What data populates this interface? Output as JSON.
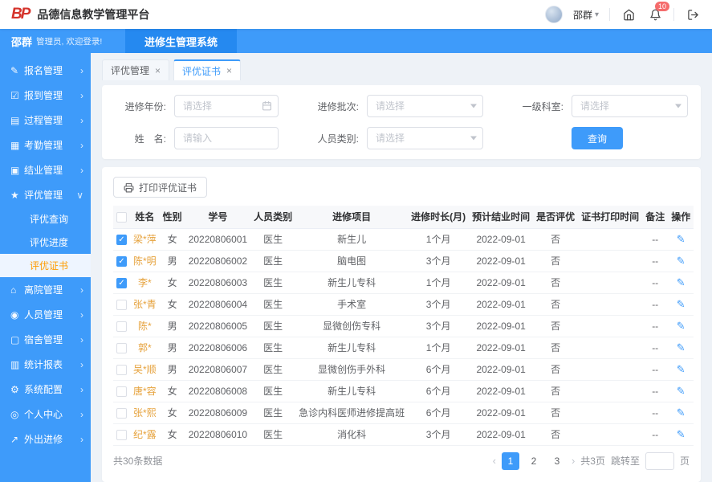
{
  "icons": {
    "chevron_right": "›",
    "chevron_down": "∨",
    "close": "×",
    "edit": "✎",
    "caret_down": "▾"
  },
  "colors": {
    "primary": "#3e9bfa",
    "primary_dark": "#2589f0",
    "submenu_active_text": "#ff9c00",
    "name_text": "#e6a23c",
    "badge": "#f56c6c",
    "logo_red": "#d5332b"
  },
  "topbar": {
    "logo_text": "BP",
    "app_title": "品德信息教学管理平台",
    "user_name": "邵群",
    "bell_badge": "10"
  },
  "bluebar": {
    "user_name": "邵群",
    "welcome": "管理员, 欢迎登录!",
    "system_title": "进修生管理系统"
  },
  "sidebar": {
    "items": [
      {
        "label": "报名管理",
        "icon": "✎"
      },
      {
        "label": "报到管理",
        "icon": "☑"
      },
      {
        "label": "过程管理",
        "icon": "▤"
      },
      {
        "label": "考勤管理",
        "icon": "▦"
      },
      {
        "label": "结业管理",
        "icon": "▣"
      },
      {
        "label": "评优管理",
        "icon": "★",
        "expanded": true,
        "children": [
          {
            "label": "评优查询"
          },
          {
            "label": "评优进度"
          },
          {
            "label": "评优证书",
            "active": true
          }
        ]
      },
      {
        "label": "离院管理",
        "icon": "⌂"
      },
      {
        "label": "人员管理",
        "icon": "◉"
      },
      {
        "label": "宿舍管理",
        "icon": "▢"
      },
      {
        "label": "统计报表",
        "icon": "▥"
      },
      {
        "label": "系统配置",
        "icon": "⚙"
      },
      {
        "label": "个人中心",
        "icon": "◎"
      },
      {
        "label": "外出进修",
        "icon": "↗"
      }
    ]
  },
  "tabs": [
    {
      "label": "评优管理",
      "active": false
    },
    {
      "label": "评优证书",
      "active": true
    }
  ],
  "filters": {
    "year_label": "进修年份:",
    "year_placeholder": "请选择",
    "batch_label": "进修批次:",
    "batch_placeholder": "请选择",
    "dept_label": "一级科室:",
    "dept_placeholder": "请选择",
    "name_label": "姓　名:",
    "name_placeholder": "请输入",
    "type_label": "人员类别:",
    "type_placeholder": "请选择",
    "query_label": "查询"
  },
  "toolbar": {
    "print_label": "打印评优证书"
  },
  "table": {
    "columns": [
      "姓名",
      "性别",
      "学号",
      "人员类别",
      "进修项目",
      "进修时长(月)",
      "预计结业时间",
      "是否评优",
      "证书打印时间",
      "备注",
      "操作"
    ],
    "rows": [
      {
        "checked": true,
        "name": "梁*萍",
        "gender": "女",
        "student_id": "20220806001",
        "person_type": "医生",
        "project": "新生儿",
        "duration": "1个月",
        "expected_end": "2022-09-01",
        "awarded": "否",
        "print_time": "",
        "remark": "--"
      },
      {
        "checked": true,
        "name": "陈*明",
        "gender": "男",
        "student_id": "20220806002",
        "person_type": "医生",
        "project": "脑电图",
        "duration": "3个月",
        "expected_end": "2022-09-01",
        "awarded": "否",
        "print_time": "",
        "remark": "--"
      },
      {
        "checked": true,
        "name": "李*",
        "gender": "女",
        "student_id": "20220806003",
        "person_type": "医生",
        "project": "新生儿专科",
        "duration": "1个月",
        "expected_end": "2022-09-01",
        "awarded": "否",
        "print_time": "",
        "remark": "--"
      },
      {
        "checked": false,
        "name": "张*青",
        "gender": "女",
        "student_id": "20220806004",
        "person_type": "医生",
        "project": "手术室",
        "duration": "3个月",
        "expected_end": "2022-09-01",
        "awarded": "否",
        "print_time": "",
        "remark": "--"
      },
      {
        "checked": false,
        "name": "陈*",
        "gender": "男",
        "student_id": "20220806005",
        "person_type": "医生",
        "project": "显微创伤专科",
        "duration": "3个月",
        "expected_end": "2022-09-01",
        "awarded": "否",
        "print_time": "",
        "remark": "--"
      },
      {
        "checked": false,
        "name": "郭*",
        "gender": "男",
        "student_id": "20220806006",
        "person_type": "医生",
        "project": "新生儿专科",
        "duration": "1个月",
        "expected_end": "2022-09-01",
        "awarded": "否",
        "print_time": "",
        "remark": "--"
      },
      {
        "checked": false,
        "name": "吴*顺",
        "gender": "男",
        "student_id": "20220806007",
        "person_type": "医生",
        "project": "显微创伤手外科",
        "duration": "6个月",
        "expected_end": "2022-09-01",
        "awarded": "否",
        "print_time": "",
        "remark": "--"
      },
      {
        "checked": false,
        "name": "唐*容",
        "gender": "女",
        "student_id": "20220806008",
        "person_type": "医生",
        "project": "新生儿专科",
        "duration": "6个月",
        "expected_end": "2022-09-01",
        "awarded": "否",
        "print_time": "",
        "remark": "--"
      },
      {
        "checked": false,
        "name": "张*熙",
        "gender": "女",
        "student_id": "20220806009",
        "person_type": "医生",
        "project": "急诊内科医师进修提高班",
        "duration": "6个月",
        "expected_end": "2022-09-01",
        "awarded": "否",
        "print_time": "",
        "remark": "--"
      },
      {
        "checked": false,
        "name": "纪*露",
        "gender": "女",
        "student_id": "20220806010",
        "person_type": "医生",
        "project": "消化科",
        "duration": "3个月",
        "expected_end": "2022-09-01",
        "awarded": "否",
        "print_time": "",
        "remark": "--"
      }
    ]
  },
  "footer": {
    "total": "共30条数据"
  },
  "pagination": {
    "prev": "‹",
    "next": "›",
    "pages": [
      "1",
      "2",
      "3"
    ],
    "active": "1",
    "total_pages": "共3页",
    "jump_label": "跳转至",
    "jump_unit": "页"
  }
}
